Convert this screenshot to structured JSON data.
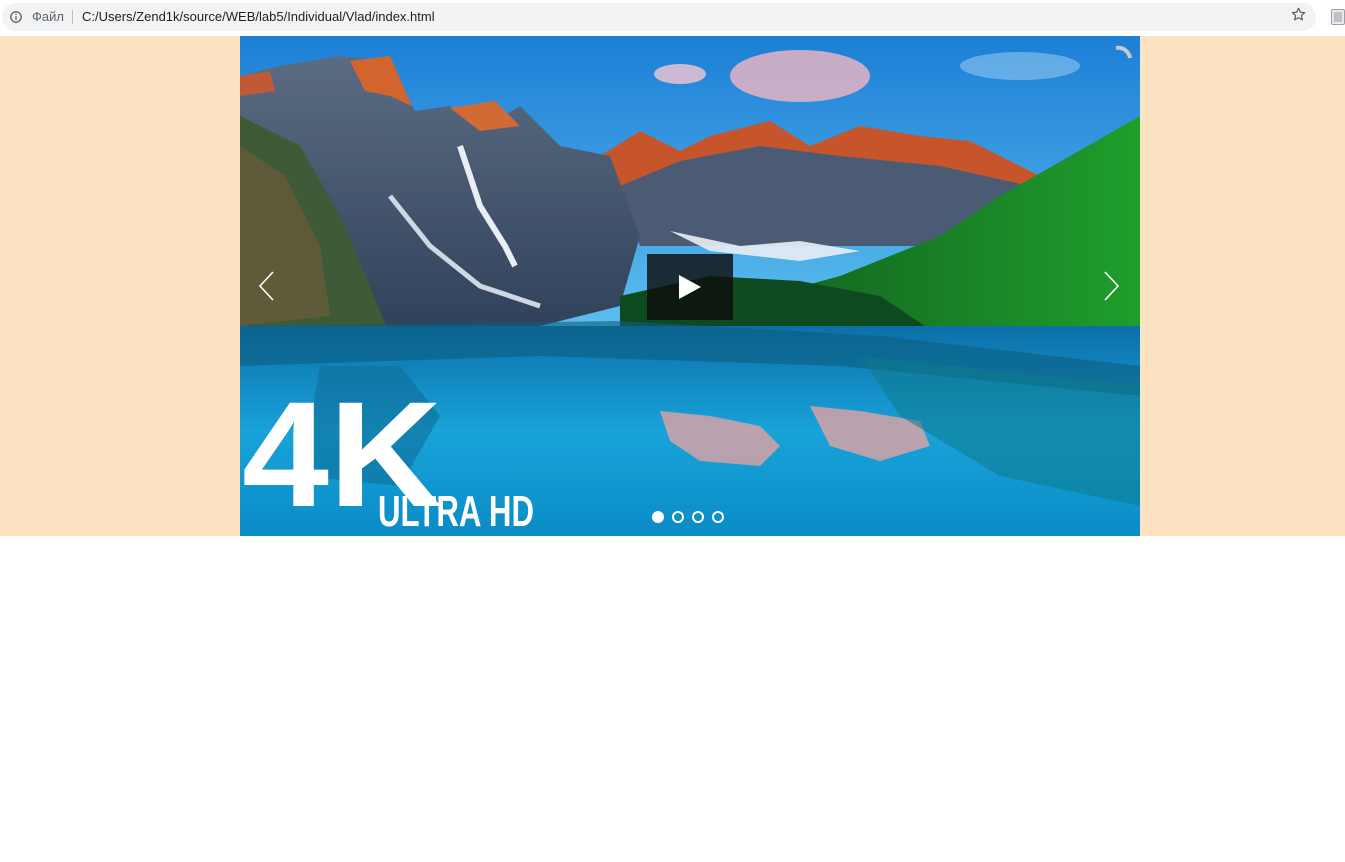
{
  "browser": {
    "scheme_label": "Файл",
    "url": "C:/Users/Zend1k/source/WEB/lab5/Individual/Vlad/index.html",
    "icons": [
      "info-icon",
      "star-icon",
      "extension-icon"
    ]
  },
  "page": {
    "background_color": "#fde3c2"
  },
  "video": {
    "badge_main": "4K",
    "badge_sub": "ULTRA HD",
    "play_icon": "play-icon",
    "prev_icon": "chevron-left-icon",
    "next_icon": "chevron-right-icon",
    "loading_icon": "spinner-icon",
    "slides_total": 4,
    "active_slide": 1
  }
}
